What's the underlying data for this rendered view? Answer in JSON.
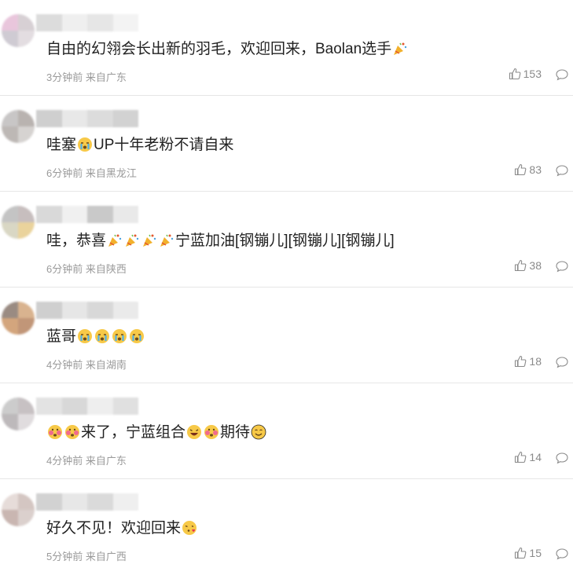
{
  "comments": [
    {
      "avatar": [
        "#e9c6dc",
        "#d7d0d4",
        "#cfcbd3",
        "#e3dde1"
      ],
      "name_blocks": [
        "#dcdcdc",
        "#efefef",
        "#e6e6e6",
        "#f3f3f3"
      ],
      "text": "自由的幻翎会长出新的羽毛，欢迎回来，Baolan选手",
      "emojis": [
        "party-popper"
      ],
      "meta": "3分钟前 来自广东",
      "likes": "153"
    },
    {
      "avatar": [
        "#c8c6c6",
        "#b9b3b0",
        "#bdb8b5",
        "#d6d3d1"
      ],
      "name_blocks": [
        "#cfcfcf",
        "#e8e8e8",
        "#dcdcdc",
        "#d2d2d2"
      ],
      "text_parts": [
        "哇塞",
        "UP十年老粉不请自来"
      ],
      "emojis": [
        "crying-face"
      ],
      "meta": "6分钟前 来自黑龙江",
      "likes": "83"
    },
    {
      "avatar": [
        "#c4c4c4",
        "#c7bebe",
        "#d9d7c4",
        "#ead39c"
      ],
      "name_blocks": [
        "#d9d9d9",
        "#f0f0f0",
        "#c9c9c9",
        "#e9e9e9"
      ],
      "text_parts": [
        "哇，恭喜",
        "宁蓝加油[钢镚儿][钢镚儿][钢镚儿]"
      ],
      "emojis": [
        "party-popper",
        "party-popper",
        "party-popper",
        "party-popper"
      ],
      "meta": "6分钟前 来自陕西",
      "likes": "38"
    },
    {
      "avatar": [
        "#9a8b82",
        "#d9b38f",
        "#d3a57d",
        "#c19678"
      ],
      "name_blocks": [
        "#cfcfcf",
        "#e6e6e6",
        "#d8d8d8",
        "#eaeaea"
      ],
      "text_parts": [
        "蓝哥",
        ""
      ],
      "emojis": [
        "crying-face",
        "crying-face",
        "crying-face",
        "crying-face"
      ],
      "meta": "4分钟前 来自湖南",
      "likes": "18"
    },
    {
      "avatar": [
        "#cccccc",
        "#c7c1c3",
        "#bdb9bb",
        "#e0dcde"
      ],
      "name_blocks": [
        "#e3e3e3",
        "#d8d8d8",
        "#eeeeee",
        "#e0e0e0"
      ],
      "text_parts": [
        "",
        "来了，宁蓝组合",
        "",
        "期待",
        ""
      ],
      "emojis": [
        "blush-face",
        "blush-face",
        "laughing-face",
        "blush-face",
        "grin-face"
      ],
      "meta": "4分钟前 来自广东",
      "likes": "14"
    },
    {
      "avatar": [
        "#e6dcd9",
        "#d4c6c2",
        "#c9b6b1",
        "#dbd0cd"
      ],
      "name_blocks": [
        "#d2d2d2",
        "#e7e7e7",
        "#dadada",
        "#efefef"
      ],
      "text_parts": [
        "好久不见！欢迎回来",
        ""
      ],
      "emojis": [
        "kiss-face"
      ],
      "meta": "5分钟前 来自广西",
      "likes": "15"
    }
  ],
  "icons": {
    "like": "thumbs-up-icon",
    "reply": "comment-bubble-icon"
  },
  "colors": {
    "text": "#222222",
    "meta": "#9a9a9a",
    "divider": "#e6e6e6"
  }
}
